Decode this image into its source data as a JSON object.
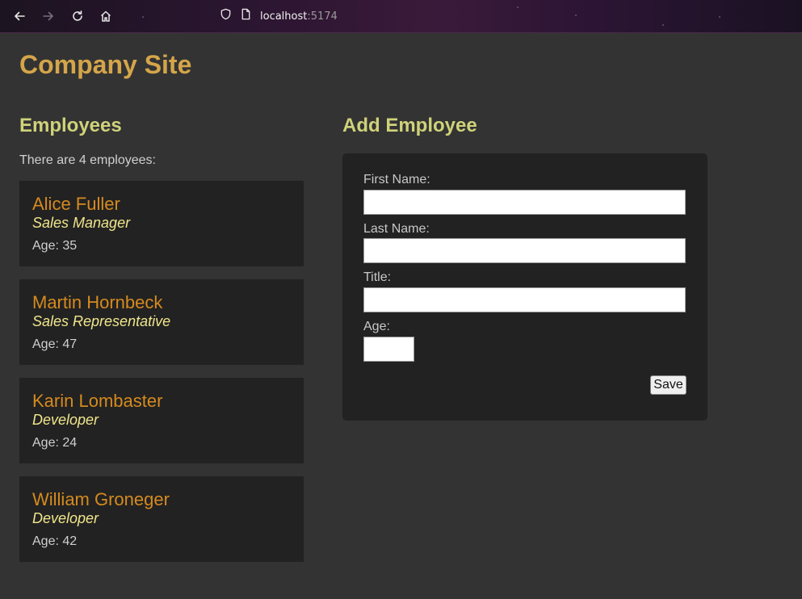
{
  "browser": {
    "url_host": "localhost",
    "url_port": ":5174"
  },
  "site": {
    "title": "Company Site"
  },
  "employees": {
    "heading": "Employees",
    "count_text": "There are 4 employees:",
    "list": [
      {
        "name": "Alice Fuller",
        "title": "Sales Manager",
        "age": "Age: 35"
      },
      {
        "name": "Martin Hornbeck",
        "title": "Sales Representative",
        "age": "Age: 47"
      },
      {
        "name": "Karin Lombaster",
        "title": "Developer",
        "age": "Age: 24"
      },
      {
        "name": "William Groneger",
        "title": "Developer",
        "age": "Age: 42"
      }
    ]
  },
  "form": {
    "heading": "Add Employee",
    "first_name_label": "First Name:",
    "first_name_value": "",
    "last_name_label": "Last Name:",
    "last_name_value": "",
    "title_label": "Title:",
    "title_value": "",
    "age_label": "Age:",
    "age_value": "",
    "save_label": "Save"
  }
}
